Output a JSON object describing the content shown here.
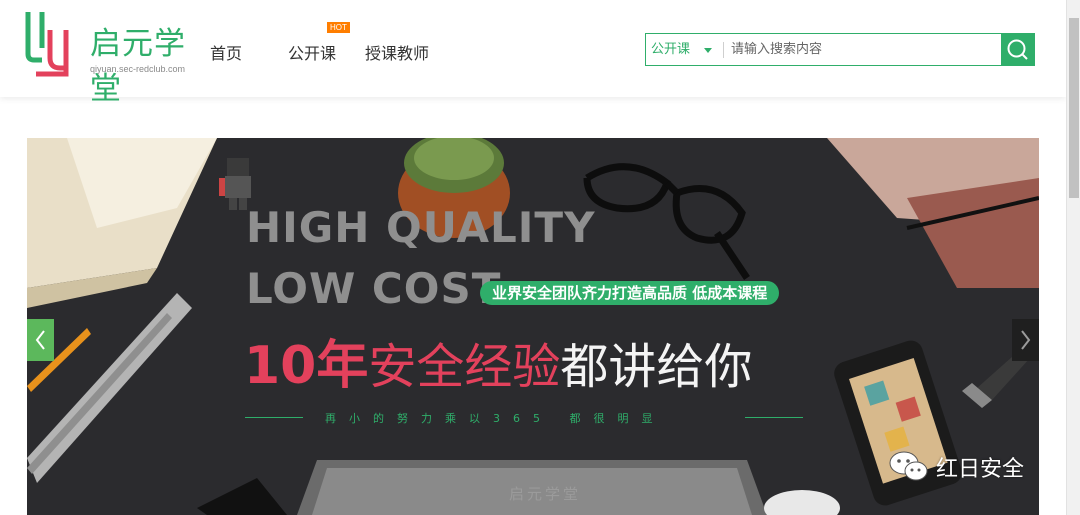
{
  "brand": {
    "name": "启元学堂",
    "url": "qiyuan.sec-redclub.com",
    "color": "#2fae6a"
  },
  "nav": {
    "home": "首页",
    "open_course": "公开课",
    "hot_badge": "HOT",
    "teachers": "授课教师"
  },
  "search": {
    "type_label": "公开课",
    "placeholder": "请输入搜索内容",
    "button_icon": "search-icon"
  },
  "banner": {
    "line1": "HIGH QUALITY",
    "line2": "LOW COST",
    "tagline": "业界安全团队齐力打造高品质 低成本课程",
    "headline_red_bold": "10年",
    "headline_red": "安全经验",
    "headline_white": "都讲给你",
    "slogan": "再小的努力乘以365 都很明显",
    "laptop_logo": "启元学堂",
    "accent_red": "#e3415c",
    "accent_green": "#2fae6a"
  },
  "watermark": {
    "text": "红日安全",
    "icon": "wechat-icon"
  }
}
